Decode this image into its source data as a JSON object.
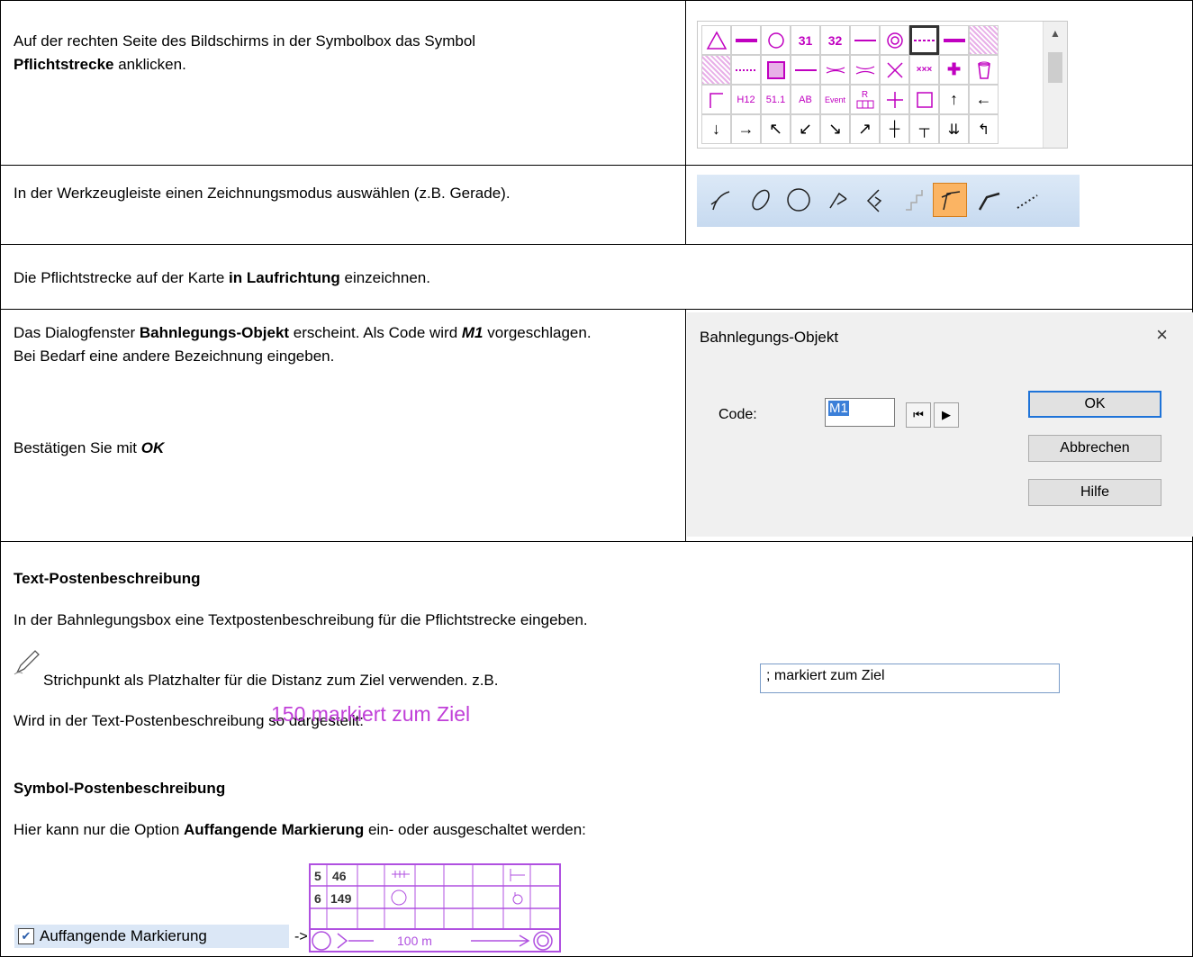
{
  "rows": {
    "step1": {
      "text1": "Auf der rechten Seite des Bildschirms in der Symbolbox das Symbol",
      "bold": "Pflichtstrecke",
      "text2": " anklicken."
    },
    "step2": {
      "text": "In der Werkzeugleiste einen Zeichnungsmodus auswählen (z.B. Gerade)."
    },
    "step3": {
      "text1": "Die Pflichtstrecke auf der Karte ",
      "bold": "in Laufrichtung",
      "text2": " einzeichnen."
    },
    "step4": {
      "text1": "Das Dialogfenster ",
      "bold1": "Bahnlegungs-Objekt",
      "text2": " erscheint. Als Code wird ",
      "bold2": "M1",
      "text3": " vorgeschlagen.",
      "line2": "Bei Bedarf eine andere Bezeichnung eingeben.",
      "confirm_text": "Bestätigen Sie mit ",
      "confirm_bold": "OK"
    }
  },
  "symbolbox": {
    "row1": [
      "31",
      "32"
    ],
    "row3": [
      "H12",
      "51.1",
      "AB",
      "Event",
      "R"
    ],
    "accent": "#c000c0"
  },
  "dialog": {
    "title": "Bahnlegungs-Objekt",
    "close": "×",
    "code_label": "Code:",
    "code_value": "M1",
    "ok": "OK",
    "cancel": "Abbrechen",
    "help": "Hilfe"
  },
  "section_text": {
    "heading": "Text-Postenbeschreibung",
    "line1": "In der Bahnlegungsbox eine Textpostenbeschreibung für die Pflichtstrecke eingeben.",
    "hint": "Strichpunkt als Platzhalter für die Distanz zum Ziel verwenden. z.B.",
    "input_value": "; markiert zum Ziel",
    "render_label": "Wird in der Text-Postenbeschreibung so dargestellt:",
    "render_value": "150 markiert zum Ziel"
  },
  "section_symbol": {
    "heading": "Symbol-Postenbeschreibung",
    "line1a": "Hier kann nur die Option ",
    "line1b": "Auffangende Markierung",
    "line1c": " ein- oder ausgeschaltet werden:",
    "checkbox_label": "Auffangende Markierung",
    "arrow": "->"
  },
  "control_table": {
    "r1": [
      "5",
      "46"
    ],
    "r2": [
      "6",
      "149"
    ],
    "distance": "100 m",
    "color": "#b050e0"
  }
}
